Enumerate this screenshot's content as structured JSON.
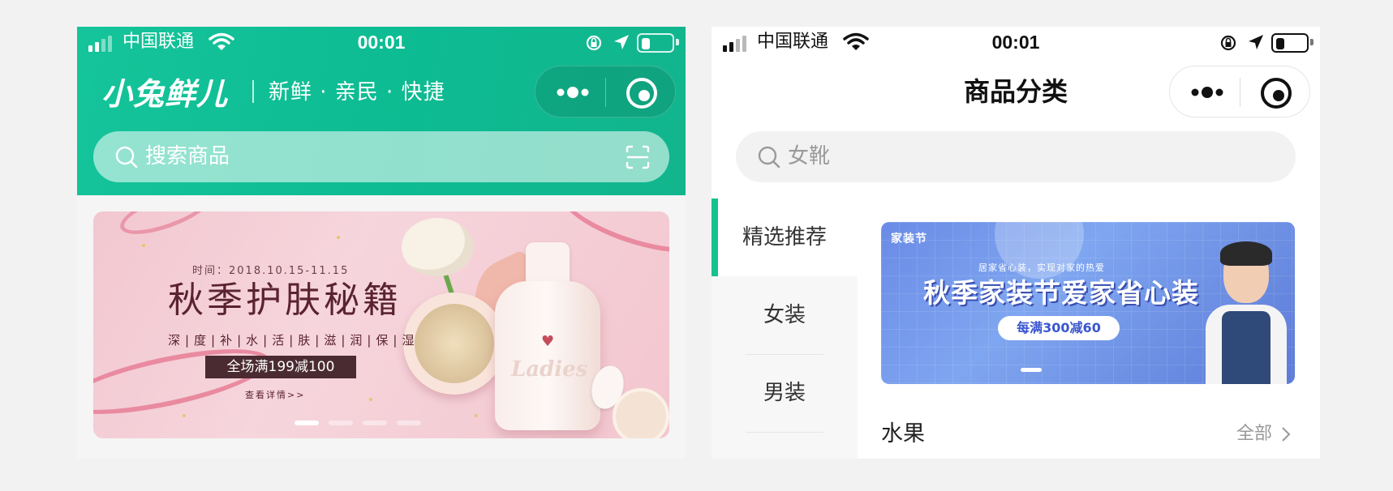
{
  "status_bar": {
    "carrier": "中国联通",
    "time": "00:01"
  },
  "home": {
    "brand": "小兔鲜儿",
    "slogan": "新鲜 · 亲民 · 快捷",
    "search_placeholder": "搜索商品",
    "banner": {
      "date": "时间：2018.10.15-11.15",
      "title": "秋季护肤秘籍",
      "features": "深|度|补|水|活|肤|滋|润|保|湿",
      "offer": "全场满199减100",
      "link": "查看详情>>",
      "product_word": "Ladies",
      "slide_count": 4,
      "active_slide": 1
    }
  },
  "category": {
    "nav_title": "商品分类",
    "search_placeholder": "女靴",
    "sidebar": [
      {
        "label": "精选推荐",
        "active": true
      },
      {
        "label": "女装",
        "active": false
      },
      {
        "label": "男装",
        "active": false
      }
    ],
    "banner": {
      "logo": "家装节",
      "subtitle": "居家省心装，实现对家的热爱",
      "title": "秋季家装节爱家省心装",
      "offer": "每满300减60"
    },
    "section": {
      "title": "水果",
      "more": "全部"
    }
  },
  "colors": {
    "brand_green": "#0dbb92",
    "active_bar": "#16c28f"
  },
  "icons": [
    "signal-icon",
    "wifi-icon",
    "lock-rotation-icon",
    "location-arrow-icon",
    "battery-icon",
    "more-icon",
    "close-target-icon",
    "search-icon",
    "scan-icon",
    "chevron-right-icon"
  ]
}
